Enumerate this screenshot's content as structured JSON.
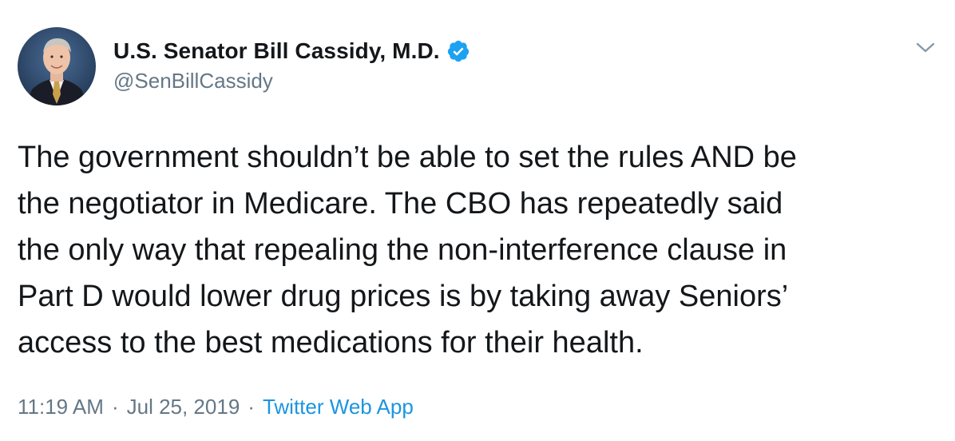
{
  "author": {
    "display_name": "U.S. Senator Bill Cassidy, M.D.",
    "handle": "@SenBillCassidy",
    "verified": true,
    "avatar_icon": "profile-photo",
    "verified_icon": "verified-badge-icon"
  },
  "tweet": {
    "lines": [
      "The government shouldn’t be able to set the rules AND be",
      "the negotiator in Medicare. The CBO has repeatedly said",
      "the only way that repealing the non-interference clause in",
      "Part D would lower drug prices is by taking away Seniors’",
      "access to the best medications for their health."
    ]
  },
  "meta": {
    "time": "11:19 AM",
    "separator": "·",
    "date": "Jul 25, 2019",
    "source": "Twitter Web App"
  },
  "colors": {
    "text": "#14171a",
    "secondary": "#657786",
    "link": "#1b95e0",
    "verified": "#1da1f2"
  },
  "menu": {
    "icon": "chevron-down-icon"
  }
}
